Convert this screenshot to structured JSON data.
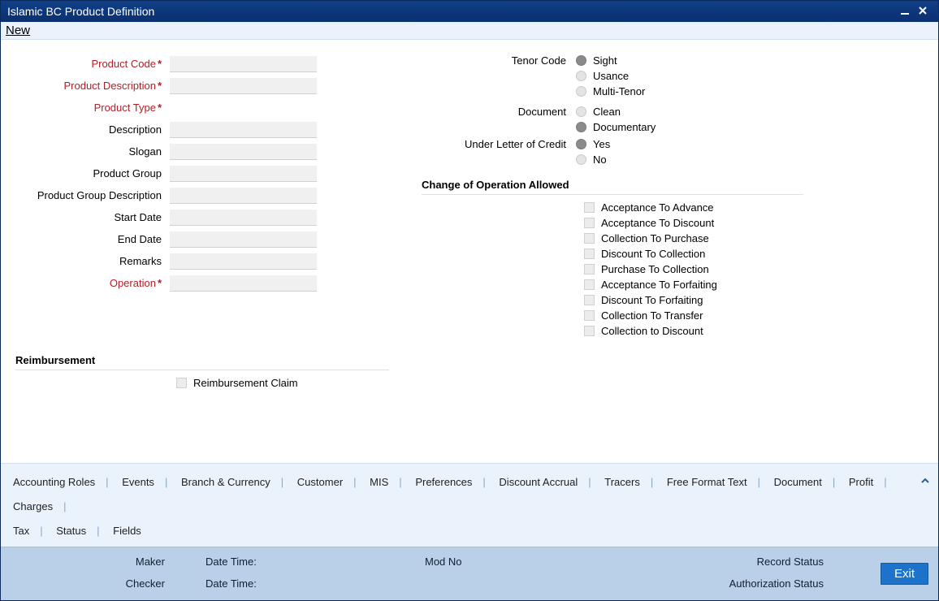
{
  "window": {
    "title": "Islamic BC Product Definition"
  },
  "menu": {
    "new_label": "New"
  },
  "fields": {
    "product_code": "Product Code",
    "product_description": "Product Description",
    "product_type": "Product Type",
    "description": "Description",
    "slogan": "Slogan",
    "product_group": "Product Group",
    "product_group_description": "Product Group Description",
    "start_date": "Start Date",
    "end_date": "End Date",
    "remarks": "Remarks",
    "operation": "Operation"
  },
  "right": {
    "tenor_code": "Tenor Code",
    "tenor_opts": {
      "sight": "Sight",
      "usance": "Usance",
      "multi": "Multi-Tenor"
    },
    "document": "Document",
    "document_opts": {
      "clean": "Clean",
      "documentary": "Documentary"
    },
    "under_loc": "Under Letter of Credit",
    "under_opts": {
      "yes": "Yes",
      "no": "No"
    }
  },
  "change_op": {
    "header": "Change of Operation Allowed",
    "items": [
      "Acceptance To Advance",
      "Acceptance To Discount",
      "Collection To Purchase",
      "Discount To Collection",
      "Purchase To Collection",
      "Acceptance To Forfaiting",
      "Discount To Forfaiting",
      "Collection To Transfer",
      "Collection to Discount"
    ]
  },
  "reimb": {
    "header": "Reimbursement",
    "claim": "Reimbursement Claim"
  },
  "tabs": [
    "Accounting Roles",
    "Events",
    "Branch & Currency",
    "Customer",
    "MIS",
    "Preferences",
    "Discount Accrual",
    "Tracers",
    "Free Format Text",
    "Document",
    "Profit",
    "Charges",
    "Tax",
    "Status",
    "Fields"
  ],
  "status": {
    "maker": "Maker",
    "checker": "Checker",
    "datetime": "Date Time:",
    "modno": "Mod No",
    "record_status": "Record Status",
    "auth_status": "Authorization Status"
  },
  "exit": "Exit"
}
